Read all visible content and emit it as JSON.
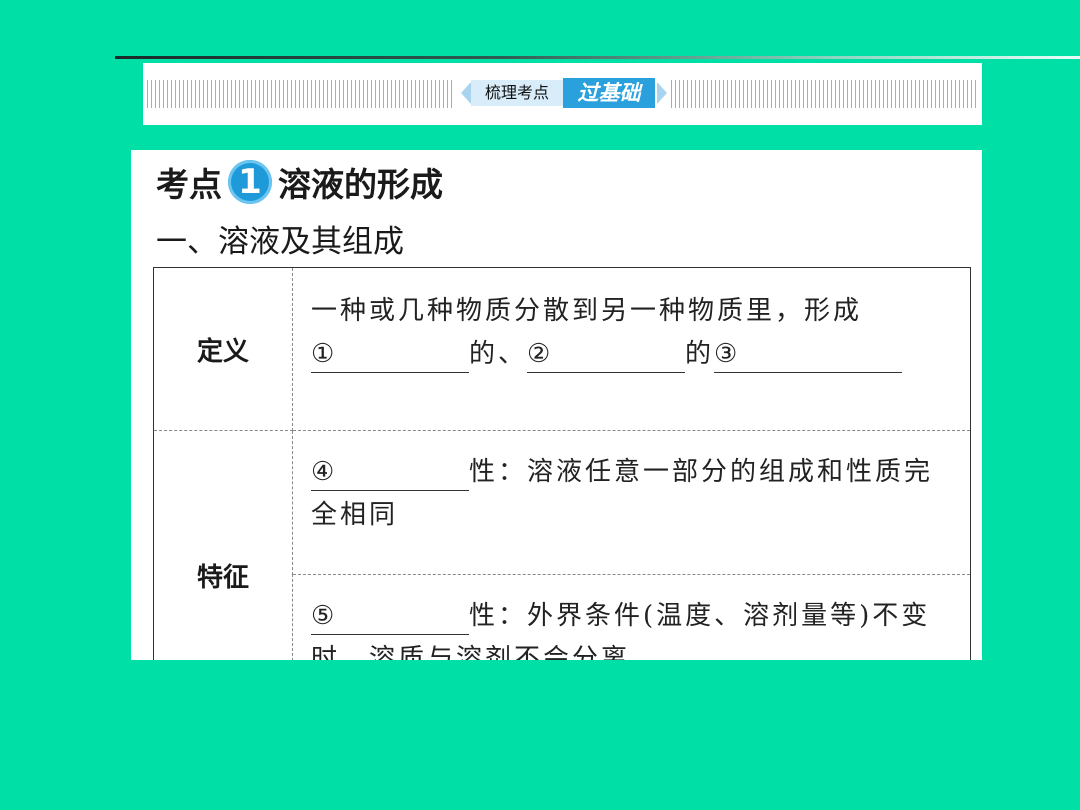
{
  "banner": {
    "tag_light": "梳理考点",
    "tag_dark": "过基础"
  },
  "heading": {
    "prefix": "考点",
    "number": "1",
    "title": "溶液的形成"
  },
  "subheading": "一、溶液及其组成",
  "table": {
    "definition": {
      "label": "定义",
      "line1": "一种或几种物质分散到另一种物质里，形成",
      "blank1": "①",
      "sep1": "的、",
      "blank2": "②",
      "sep2": "的",
      "blank3": "③"
    },
    "features": {
      "label": "特征",
      "item1": {
        "blank": "④",
        "text": "性：溶液任意一部分的组成和性质完全相同"
      },
      "item2": {
        "blank": "⑤",
        "text": "性：外界条件(温度、溶剂量等)不变时，溶质与溶剂不会分离"
      }
    }
  },
  "colors": {
    "background": "#00e0a6",
    "accent_blue": "#2aa0dc",
    "light_blue": "#d8ecfa"
  }
}
